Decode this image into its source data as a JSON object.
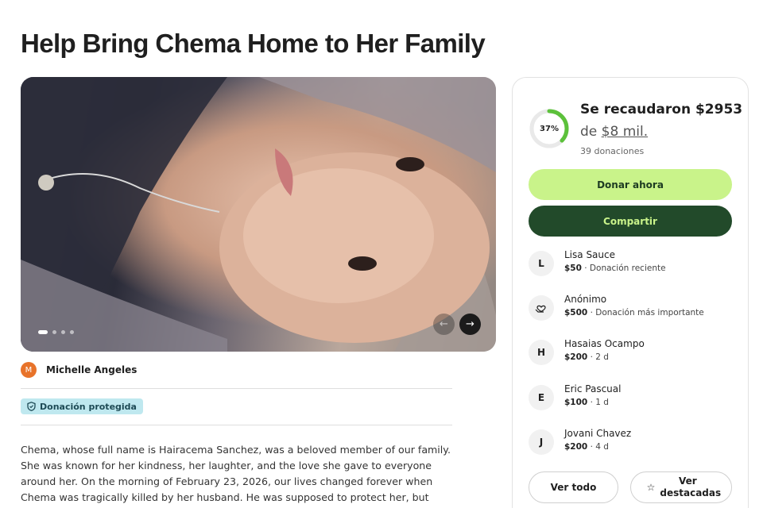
{
  "campaign": {
    "title": "Help Bring Chema Home to Her Family",
    "organizer": {
      "initial": "M",
      "name": "Michelle Angeles"
    },
    "protected_badge": "Donación protegida",
    "story": "Chema, whose full name is Hairacema Sanchez, was a beloved member of our family. She was known for her kindness, her laughter, and the love she gave to everyone around her. On the morning of February 23, 2026, our lives changed forever when Chema was tragically killed by her husband. He was supposed to protect her, but instead, his abusive and"
  },
  "gallery": {
    "slide_count": 4,
    "active_slide": 1,
    "prev_icon": "←",
    "next_icon": "→"
  },
  "donation_card": {
    "progress_percent": 37,
    "progress_label": "37%",
    "raised_text": "Se recaudaron $2953",
    "goal_prefix": "de",
    "goal_amount": "$8 mil.",
    "donation_count": "39 donaciones",
    "donate_label": "Donar ahora",
    "share_label": "Compartir",
    "donors": [
      {
        "avatar": "L",
        "name": "Lisa Sauce",
        "amount": "$50",
        "note": " · Donación reciente"
      },
      {
        "avatar": "",
        "name": "Anónimo",
        "amount": "$500",
        "note": " · Donación más importante"
      },
      {
        "avatar": "H",
        "name": "Hasaias Ocampo",
        "amount": "$200",
        "note": " · 2 d"
      },
      {
        "avatar": "E",
        "name": "Eric Pascual",
        "amount": "$100",
        "note": " · 1 d"
      },
      {
        "avatar": "J",
        "name": "Jovani Chavez",
        "amount": "$200",
        "note": " · 4 d"
      }
    ],
    "see_all_label": "Ver todo",
    "see_top_label": "Ver destacadas",
    "accent_color": "#c9f38a",
    "dark_green": "#224a2a",
    "progress_color": "#5cc13b"
  }
}
